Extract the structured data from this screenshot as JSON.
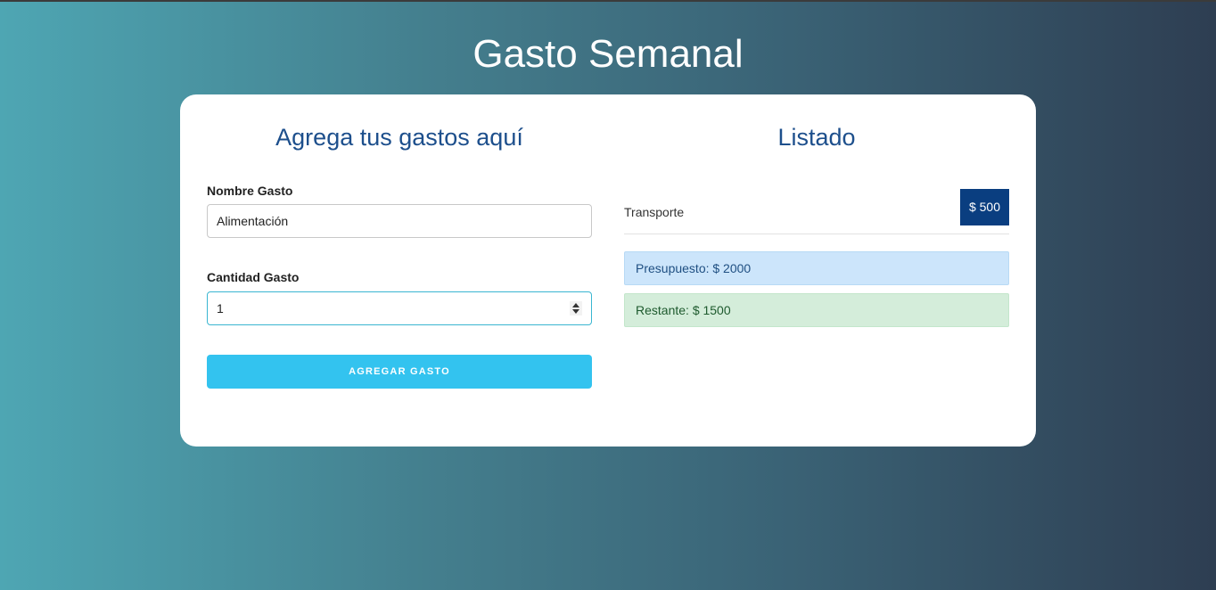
{
  "header": {
    "title": "Gasto Semanal"
  },
  "form": {
    "title": "Agrega tus gastos aquí",
    "name_label": "Nombre Gasto",
    "name_value": "Alimentación",
    "amount_label": "Cantidad Gasto",
    "amount_value": "1",
    "submit_label": "AGREGAR GASTO"
  },
  "list": {
    "title": "Listado",
    "items": [
      {
        "name": "Transporte",
        "amount": "$ 500"
      }
    ],
    "budget_text": "Presupuesto: $ 2000",
    "remaining_text": "Restante: $ 1500"
  },
  "colors": {
    "title_blue": "#1d4f8c",
    "button_cyan": "#33c3ef",
    "badge_navy": "#0a3e80",
    "budget_bg": "#cce5fb",
    "remaining_bg": "#d4edda"
  }
}
